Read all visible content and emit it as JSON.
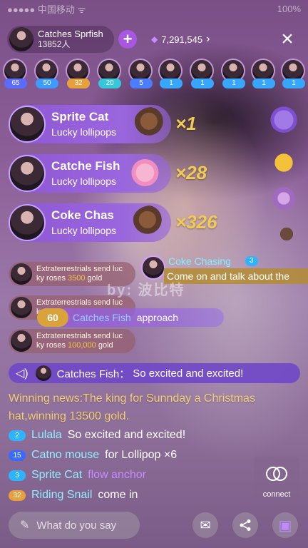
{
  "status_bar": {
    "left": "●●●●● 中国移动 ᯤ",
    "right": "100%"
  },
  "host": {
    "name": "Catches Sprfish",
    "followers": "13852人"
  },
  "add_button": "+",
  "coins": {
    "value": "7,291,545",
    "arrow": "›"
  },
  "close_symbol": "×",
  "viewers": [
    {
      "badge": "65",
      "color": "#5a6cff"
    },
    {
      "badge": "50",
      "color": "#3b9bff"
    },
    {
      "badge": "32",
      "color": "#e8a13a"
    },
    {
      "badge": "20",
      "color": "#36c8d8"
    },
    {
      "badge": "5",
      "color": "#4a7dff"
    },
    {
      "badge": "1",
      "color": "#36a6ff"
    },
    {
      "badge": "1",
      "color": "#36a6ff"
    },
    {
      "badge": "1",
      "color": "#36a6ff"
    },
    {
      "badge": "1",
      "color": "#36a6ff"
    },
    {
      "badge": "1",
      "color": "#36a6ff"
    }
  ],
  "gift_banners": [
    {
      "name": "Sprite Cat",
      "gift": "Lucky lollipops",
      "count": "×1"
    },
    {
      "name": "Catche Fish",
      "gift": "Lucky lollipops",
      "count": "×28"
    },
    {
      "name": "Coke Chas",
      "gift": "Lucky lollipops",
      "count": "×326"
    }
  ],
  "notices": [
    {
      "line1": "Extraterrestrials send luc",
      "line2_pre": "ky roses ",
      "amount": "3500",
      "line2_post": " gold"
    },
    {
      "line1": "Extraterrestrials send luc",
      "line2_pre": "ky roses ",
      "amount": "",
      "line2_post": ""
    },
    {
      "line1": "Extraterrestrials send luc",
      "line2_pre": "ky roses ",
      "amount": "100,000",
      "line2_post": " gold"
    }
  ],
  "chase": {
    "name": "Coke Chasing",
    "level": "3",
    "message": "Come on and talk about the"
  },
  "watermark": "by: 波比特",
  "approach": {
    "level": "60",
    "name": "Catches Fish",
    "action": "approach"
  },
  "system_message": {
    "user": "Catches Fish：",
    "text": "So excited and excited!"
  },
  "winning_news": "Winning news:The king for Sunnday a Christmas hat,winning 13500 gold.",
  "chat": [
    {
      "level": "2",
      "level_color": "#2db4ff",
      "user": "Lulala",
      "text": "So excited and excited!",
      "text_color": "#ffffff"
    },
    {
      "level": "15",
      "level_color": "#3a6bff",
      "user": "Catno mouse",
      "text": "for Lollipop ×6",
      "text_color": "#ffffff"
    },
    {
      "level": "3",
      "level_color": "#2db4ff",
      "user": "Sprite Cat",
      "text": "flow anchor",
      "text_color": "#c58cff"
    },
    {
      "level": "32",
      "level_color": "#e8a13a",
      "user": "Riding Snail",
      "text": "come in",
      "text_color": "#ffffff"
    }
  ],
  "connect_label": "connect",
  "input_placeholder": "What do you say"
}
